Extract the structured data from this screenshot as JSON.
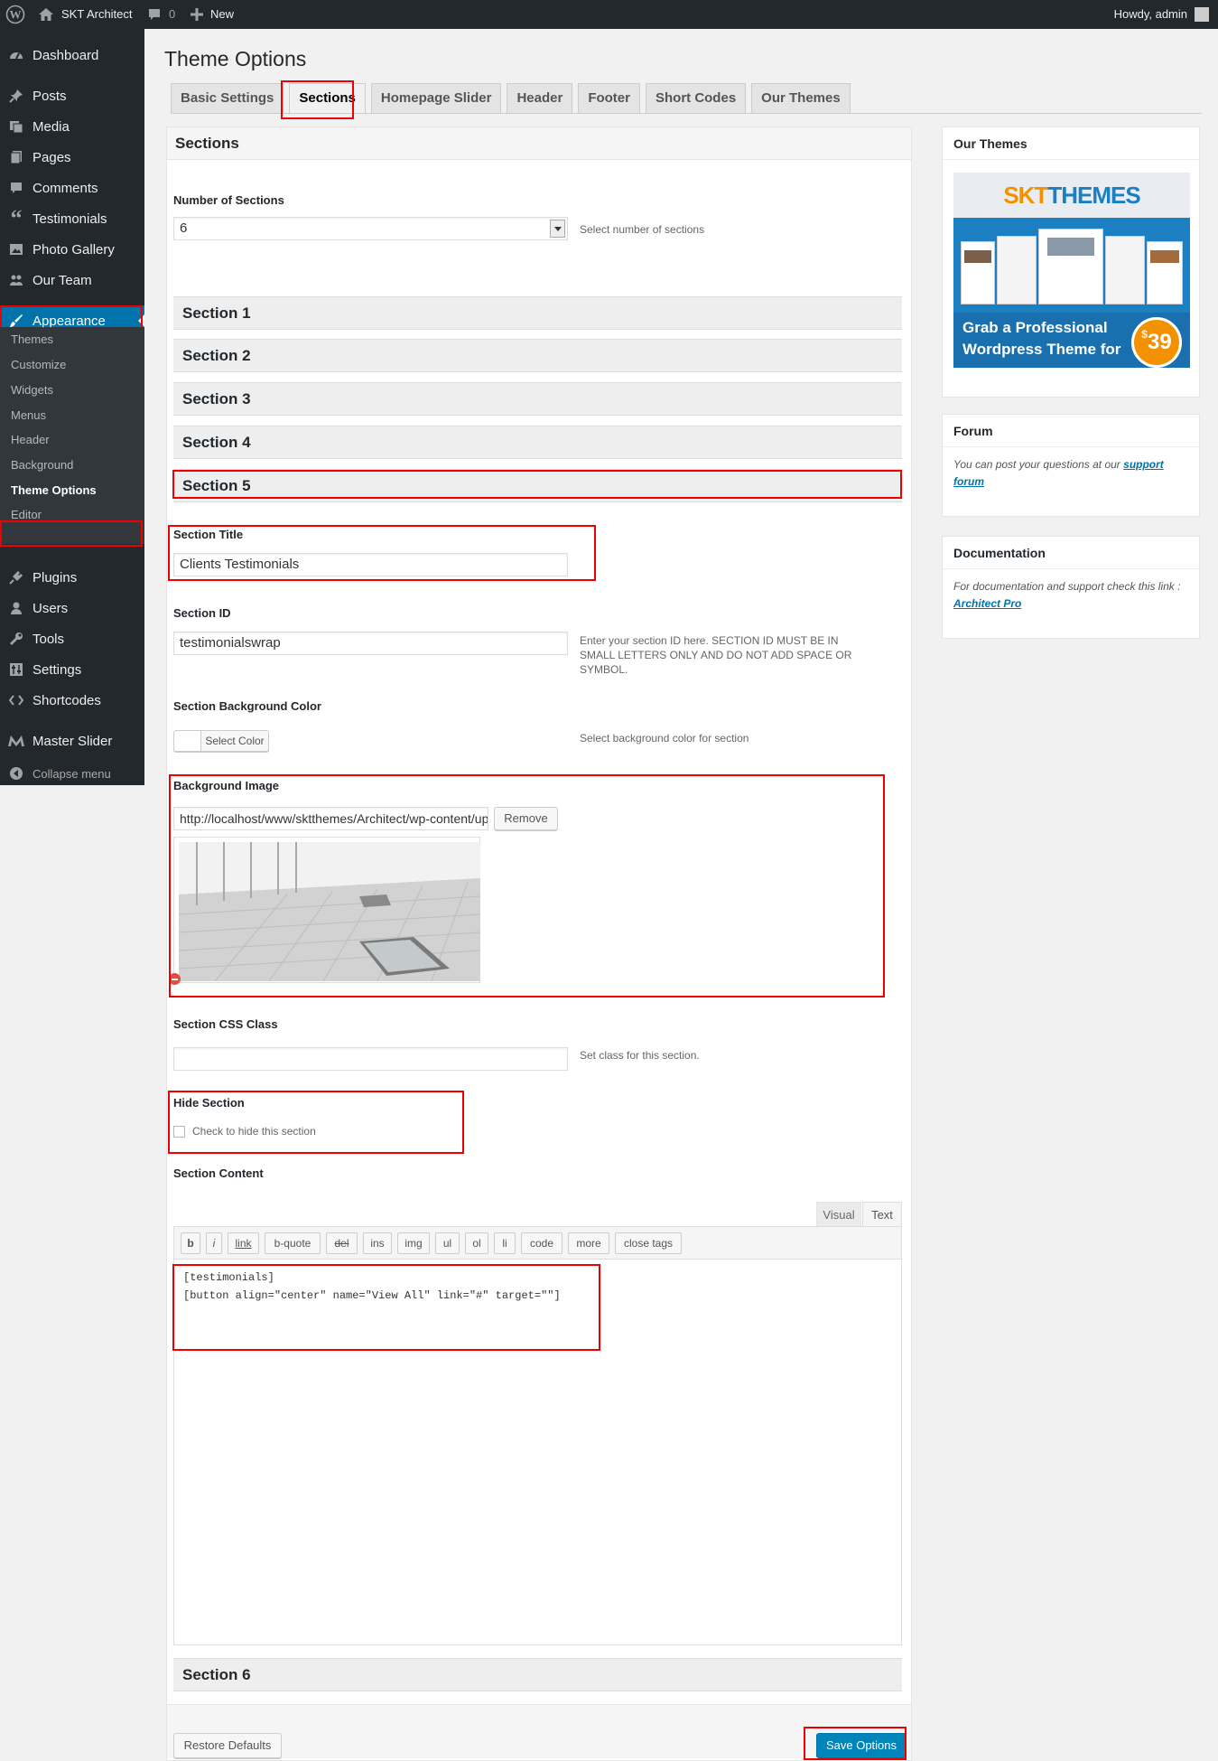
{
  "adminbar": {
    "site_name": "SKT Architect",
    "comments_count": "0",
    "new_label": "New",
    "howdy": "Howdy, admin"
  },
  "sidebar": {
    "items": [
      {
        "label": "Dashboard",
        "icon": "dashboard-icon"
      },
      {
        "label": "Posts",
        "icon": "pin-icon"
      },
      {
        "label": "Media",
        "icon": "media-icon"
      },
      {
        "label": "Pages",
        "icon": "pages-icon"
      },
      {
        "label": "Comments",
        "icon": "comment-icon"
      },
      {
        "label": "Testimonials",
        "icon": "quote-icon"
      },
      {
        "label": "Photo Gallery",
        "icon": "gallery-icon"
      },
      {
        "label": "Our Team",
        "icon": "team-icon"
      },
      {
        "label": "Appearance",
        "icon": "brush-icon"
      },
      {
        "label": "Plugins",
        "icon": "plugin-icon"
      },
      {
        "label": "Users",
        "icon": "user-icon"
      },
      {
        "label": "Tools",
        "icon": "wrench-icon"
      },
      {
        "label": "Settings",
        "icon": "settings-icon"
      },
      {
        "label": "Shortcodes",
        "icon": "code-icon"
      },
      {
        "label": "Master Slider",
        "icon": "master-slider-icon"
      },
      {
        "label": "Collapse menu",
        "icon": "collapse-icon"
      }
    ],
    "submenu": [
      "Themes",
      "Customize",
      "Widgets",
      "Menus",
      "Header",
      "Background",
      "Theme Options",
      "Editor"
    ]
  },
  "main": {
    "title": "Theme Options",
    "tabs": [
      "Basic Settings",
      "Sections",
      "Homepage Slider",
      "Header",
      "Footer",
      "Short Codes",
      "Our Themes"
    ],
    "panel_title": "Sections",
    "num_sections_label": "Number of Sections",
    "num_sections_value": "6",
    "num_sections_desc": "Select number of sections",
    "sections": [
      "Section 1",
      "Section 2",
      "Section 3",
      "Section 4",
      "Section 5",
      "Section 6"
    ],
    "section_title_label": "Section Title",
    "section_title_value": "Clients Testimonials",
    "section_id_label": "Section ID",
    "section_id_value": "testimonialswrap",
    "section_id_desc": "Enter your section ID here. SECTION ID MUST BE IN SMALL LETTERS ONLY AND DO NOT ADD SPACE OR SYMBOL.",
    "bg_color_label": "Section Background Color",
    "select_color": "Select Color",
    "bg_color_desc": "Select background color for section",
    "bg_image_label": "Background Image",
    "bg_image_url": "http://localhost/www/sktthemes/Architect/wp-content/uploads/2015/04/testimonial-bg.jpg",
    "remove_label": "Remove",
    "css_class_label": "Section CSS Class",
    "css_class_value": "",
    "css_class_desc": "Set class for this section.",
    "hide_label": "Hide Section",
    "hide_check_label": "Check to hide this section",
    "content_label": "Section Content",
    "editor_tabs": [
      "Visual",
      "Text"
    ],
    "quicktags": [
      "b",
      "i",
      "link",
      "b-quote",
      "del",
      "ins",
      "img",
      "ul",
      "ol",
      "li",
      "code",
      "more",
      "close tags"
    ],
    "content_line1": "[testimonials]",
    "content_line2": "[button align=\"center\" name=\"View All\" link=\"#\" target=\"\"]",
    "restore_label": "Restore Defaults",
    "save_label": "Save Options"
  },
  "widgets": {
    "our_themes_title": "Our Themes",
    "banner_brand_a": "SKT",
    "banner_brand_b": "THEMES",
    "banner_line1": "Grab a Professional",
    "banner_line2": "Wordpress Theme for",
    "banner_price_symbol": "$",
    "banner_price": "39",
    "forum_title": "Forum",
    "forum_text": "You can post your questions at our",
    "forum_link": "support forum",
    "doc_title": "Documentation",
    "doc_text": "For documentation and support check this link :",
    "doc_link": "Architect Pro"
  },
  "colors": {
    "accent": "#0073aa",
    "highlight": "#e00000",
    "admin_dark": "#23282d"
  }
}
